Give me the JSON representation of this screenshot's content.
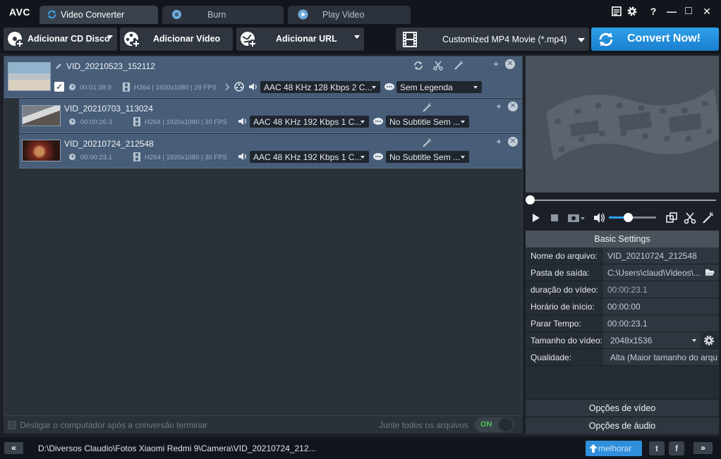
{
  "app": {
    "logo": "AVC",
    "tabs": [
      {
        "label": "Video Converter",
        "icon": "convert-icon"
      },
      {
        "label": "Burn",
        "icon": "disc-icon"
      },
      {
        "label": "Play Video",
        "icon": "play-icon"
      }
    ],
    "window": {
      "help": "?",
      "minimize": "—",
      "maximize": "□",
      "close": "✕"
    }
  },
  "toolbar": {
    "add_cd": "Adicionar CD Disco",
    "add_video": "Adicionar Vídeo",
    "add_url": "Adicionar URL",
    "format": "Customized MP4 Movie (*.mp4)",
    "convert": "Convert Now!"
  },
  "files": [
    {
      "name": "VID_20210523_152112",
      "duration": "00:01:38.9",
      "video_info": "H264 | 1920x1080 | 29 FPS",
      "audio": "AAC 48 KHz 128 Kbps 2 C...",
      "subtitle": "Sem Legenda",
      "checked": "✓"
    },
    {
      "name": "VID_20210703_113024",
      "duration": "00:00:26.3",
      "video_info": "H264 | 1920x1080 | 30 FPS",
      "audio": "AAC 48 KHz 192 Kbps 1 C...",
      "subtitle": "No Subtitle Sem ..."
    },
    {
      "name": "VID_20210724_212548",
      "duration": "00:00:23.1",
      "video_info": "H264 | 1920x1080 | 30 FPS",
      "audio": "AAC 48 KHz 192 Kbps 1 C...",
      "subtitle": "No Subtitle Sem ..."
    }
  ],
  "list_footer": {
    "shutdown": "Desligar o computador após a conversão terminar",
    "merge": "Junte todos os arquivos",
    "merge_toggle": "ON"
  },
  "player": {
    "seek_position": 0.0,
    "volume_level": 0.4
  },
  "settings": {
    "header": "Basic Settings",
    "rows": [
      {
        "label": "Nome do arquivo:",
        "value": "VID_20210724_212548"
      },
      {
        "label": "Pasta de saída:",
        "value": "C:\\Users\\claud\\Videos\\..."
      },
      {
        "label": "duração do vídeo:",
        "value": "00:00:23.1"
      },
      {
        "label": "Horário de início:",
        "value": "00:00:00"
      },
      {
        "label": "Parar Tempo:",
        "value": "00:00:23.1"
      },
      {
        "label": "Tamanho do vídeo:",
        "value": "2048x1536"
      },
      {
        "label": "Qualidade:",
        "value": "Alta (Maior tamanho do arquivo)"
      }
    ],
    "video_options": "Opções de vídeo",
    "audio_options": "Opções de áudio"
  },
  "statusbar": {
    "collapse": "«",
    "path": "D:\\Diversos Claudio\\Fotos Xiaomi Redmi 9\\Camera\\VID_20210724_212...",
    "improve": "melhorar",
    "twitter": "t",
    "facebook": "f",
    "expand": "»"
  },
  "colors": {
    "accent": "#2fa0e8",
    "row_bg": "#475d78",
    "toggle_on": "#4fbf5a"
  }
}
